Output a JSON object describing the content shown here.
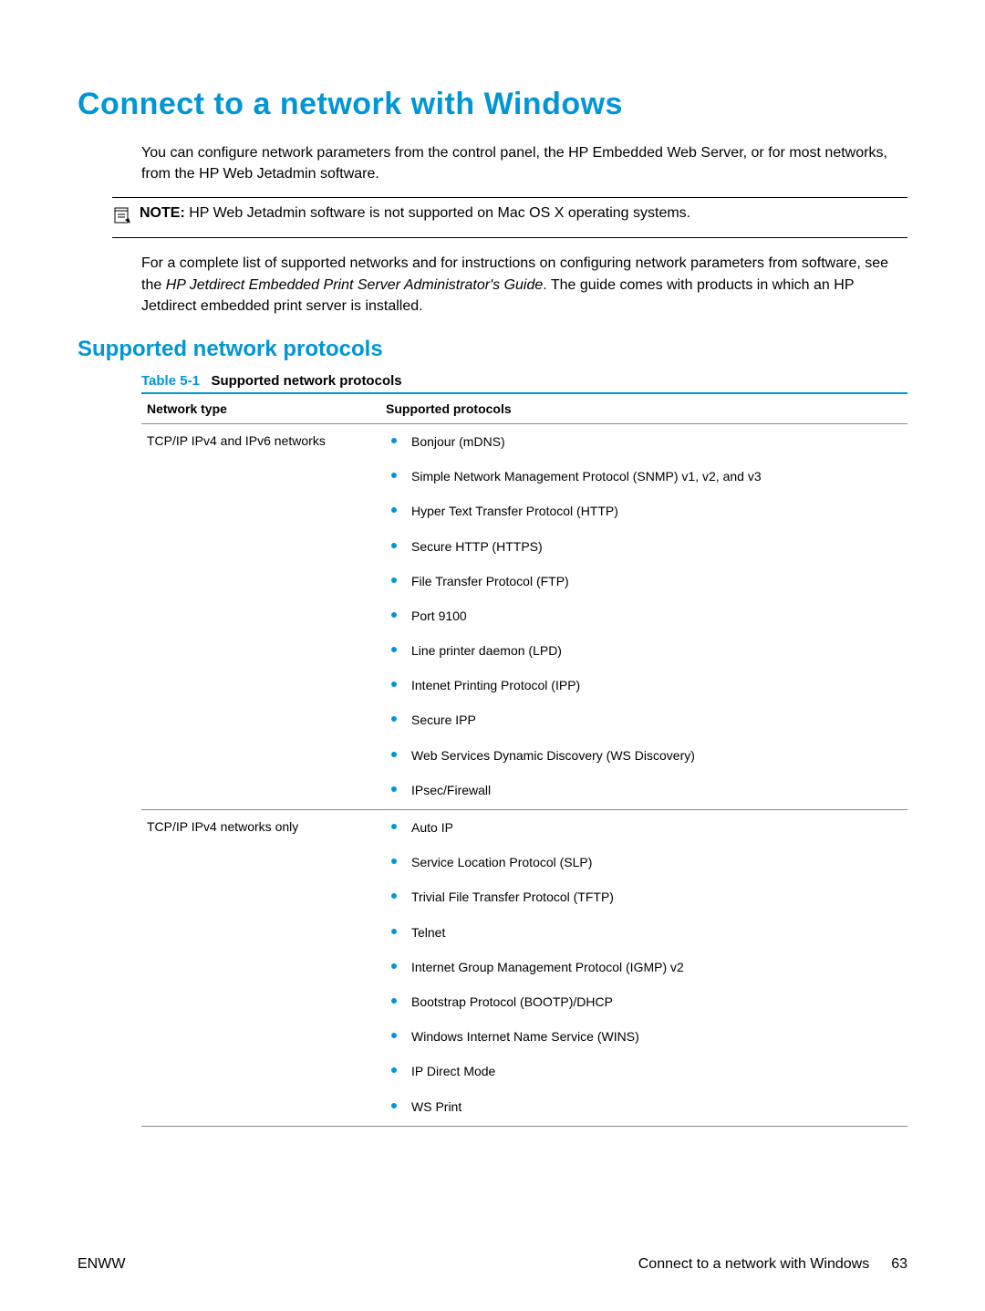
{
  "title": "Connect to a network with Windows",
  "intro": "You can configure network parameters from the control panel, the HP Embedded Web Server, or for most networks, from the HP Web Jetadmin software.",
  "note": {
    "label": "NOTE:",
    "text": "HP Web Jetadmin software is not supported on Mac OS X operating systems."
  },
  "guide_para": {
    "pre": "For a complete list of supported networks and for instructions on configuring network parameters from software, see the ",
    "italic": "HP Jetdirect Embedded Print Server Administrator's Guide",
    "post": ". The guide comes with products in which an HP Jetdirect embedded print server is installed."
  },
  "subheading": "Supported network protocols",
  "table": {
    "caption_label": "Table 5-1",
    "caption_title": "Supported network protocols",
    "headers": {
      "col1": "Network type",
      "col2": "Supported protocols"
    },
    "rows": [
      {
        "network_type": "TCP/IP IPv4 and IPv6 networks",
        "protocols": [
          "Bonjour (mDNS)",
          "Simple Network Management Protocol (SNMP) v1, v2, and v3",
          "Hyper Text Transfer Protocol (HTTP)",
          "Secure HTTP (HTTPS)",
          "File Transfer Protocol (FTP)",
          "Port 9100",
          "Line printer daemon (LPD)",
          "Intenet Printing Protocol (IPP)",
          "Secure IPP",
          "Web Services Dynamic Discovery (WS Discovery)",
          "IPsec/Firewall"
        ]
      },
      {
        "network_type": "TCP/IP IPv4 networks only",
        "protocols": [
          "Auto IP",
          "Service Location Protocol (SLP)",
          "Trivial File Transfer Protocol (TFTP)",
          "Telnet",
          "Internet Group Management Protocol (IGMP) v2",
          "Bootstrap Protocol (BOOTP)/DHCP",
          "Windows Internet Name Service (WINS)",
          "IP Direct Mode",
          "WS Print"
        ]
      }
    ]
  },
  "footer": {
    "left": "ENWW",
    "right_text": "Connect to a network with Windows",
    "page": "63"
  }
}
